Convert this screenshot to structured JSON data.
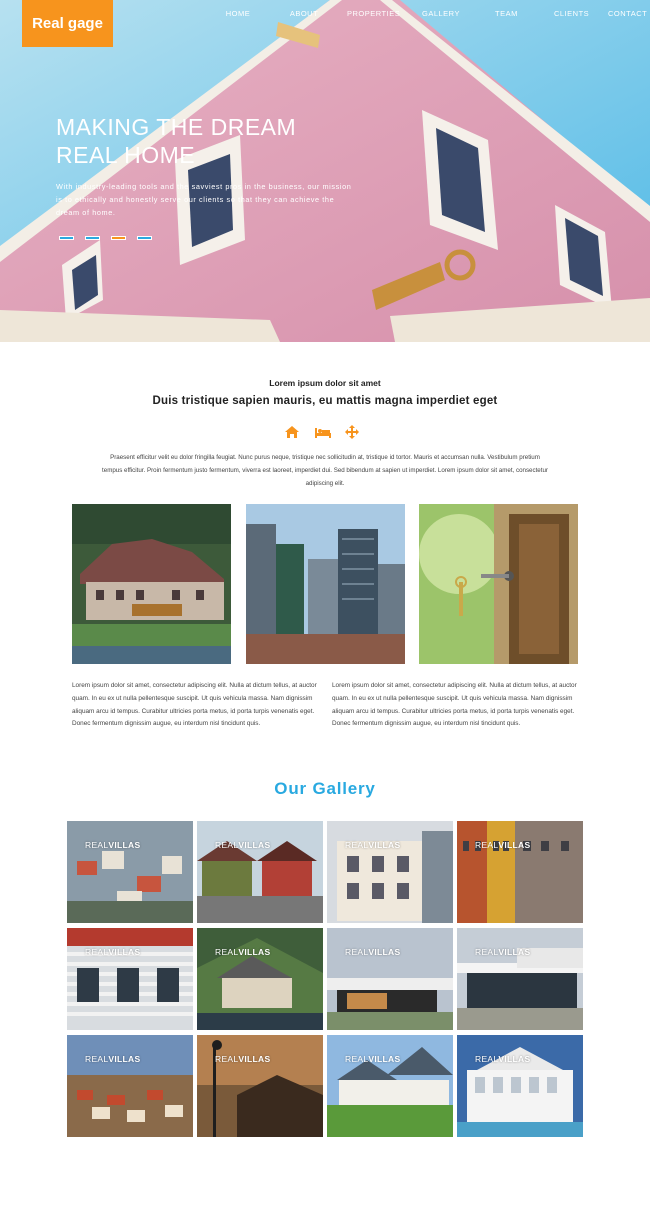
{
  "brand": {
    "name": "Real gage"
  },
  "nav": [
    "HOME",
    "ABOUT",
    "PROPERTIES",
    "GALLERY",
    "TEAM",
    "CLIENTS",
    "CONTACT"
  ],
  "hero": {
    "title_line1": "MAKING THE DREAM",
    "title_line2": "REAL HOME",
    "text": "With industry-leading tools and the savviest pros in the business, our mission is to ethically and honestly serve our clients so that they can achieve the dream of home.",
    "slides": 4,
    "active_slide": 3
  },
  "intro": {
    "kicker": "Lorem ipsum dolor sit amet",
    "headline": "Duis tristique sapien mauris, eu mattis magna imperdiet eget",
    "icons": [
      "home-icon",
      "bed-icon",
      "move-arrows-icon"
    ],
    "accent": "#f7941d",
    "paragraph": "Praesent efficitur velit eu dolor fringilla feugiat. Nunc purus neque, tristique nec sollicitudin at, tristique id tortor. Mauris et accumsan nulla. Vestibulum pretium tempus efficitur. Proin fermentum justo fermentum, viverra est laoreet, imperdiet dui. Sed bibendum at sapien ut imperdiet. Lorem ipsum dolor sit amet, consectetur adipiscing elit."
  },
  "columns": [
    "Lorem ipsum dolor sit amet, consectetur adipiscing elit. Nulla at dictum tellus, at auctor quam. In eu ex ut nulla pellentesque suscipit. Ut quis vehicula massa. Nam dignissim aliquam arcu id tempus. Curabitur ultricies porta metus, id porta turpis venenatis eget. Donec fermentum dignissim augue, eu interdum nisl tincidunt quis.",
    "Lorem ipsum dolor sit amet, consectetur adipiscing elit. Nulla at dictum tellus, at auctor quam. In eu ex ut nulla pellentesque suscipit. Ut quis vehicula massa. Nam dignissim aliquam arcu id tempus. Curabitur ultricies porta metus, id porta turpis venenatis eget. Donec fermentum dignissim augue, eu interdum nisl tincidunt quis."
  ],
  "gallery": {
    "title": "Our Gallery",
    "caption_light": "REAL",
    "caption_bold": "VILLAS",
    "tiles": 12,
    "accent": "#29a9e0"
  }
}
